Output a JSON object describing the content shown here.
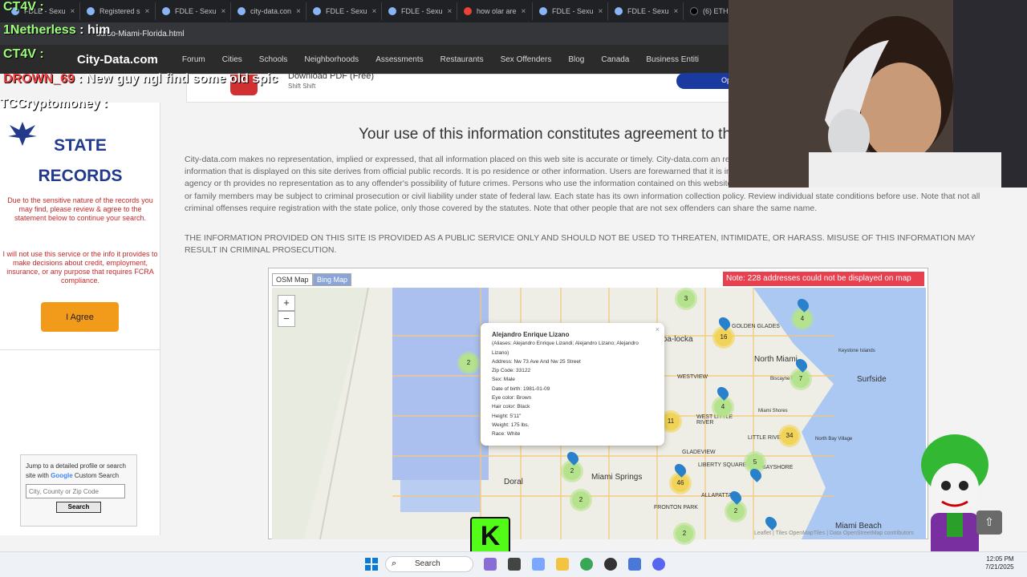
{
  "browser": {
    "tabs": [
      {
        "label": "FDLE - Sexu",
        "icon": "fdle-icon"
      },
      {
        "label": "Registered s",
        "icon": "globe-icon"
      },
      {
        "label": "FDLE - Sexu",
        "icon": "fdle-icon"
      },
      {
        "label": "city-data.con",
        "icon": "globe-icon"
      },
      {
        "label": "FDLE - Sexu",
        "icon": "fdle-icon"
      },
      {
        "label": "FDLE - Sexu",
        "icon": "fdle-icon"
      },
      {
        "label": "how olar are",
        "icon": "google-icon"
      },
      {
        "label": "FDLE - Sexu",
        "icon": "fdle-icon"
      },
      {
        "label": "FDLE - Sexu",
        "icon": "fdle-icon"
      },
      {
        "label": "(6) ETHM",
        "icon": "x-icon"
      }
    ],
    "url": "so/so-Miami-Florida.html"
  },
  "site": {
    "logo": "City-Data.com",
    "nav": [
      "Forum",
      "Cities",
      "Schools",
      "Neighborhoods",
      "Assessments",
      "Restaurants",
      "Sex Offenders",
      "Blog",
      "Canada",
      "Business Entiti"
    ],
    "ad": {
      "title": "Download PDF (Free)",
      "sub": "Shift Shift",
      "button": "Op"
    }
  },
  "left": {
    "title1": "STATE",
    "title2": "RECORDS",
    "warning1": "Due to the sensitive nature of the records you may find, please review & agree to the statement below to continue your search.",
    "warning2": "I will not use this service or the info it provides to make decisions about credit, employment, insurance, or any purpose that requires FCRA compliance.",
    "agree_button": "I Agree",
    "search_intro": "Jump to a detailed profile or search site with",
    "search_brand": "Google",
    "search_brand_suffix": " Custom Search",
    "search_placeholder": "City, County or Zip Code",
    "search_button": "Search"
  },
  "main": {
    "heading": "Your use of this information constitutes agreement to the",
    "para1": "City-data.com makes no representation, implied or expressed, that all information placed on this web site is accurate or timely. City-data.com an resulting from reliance on this information or lack thereof. The information that is displayed on this site derives from official public records. It is po residence or other information. Users are forewarned that it is incumbent upon them to verify information with the responsible state agency or th provides no representation as to any offender's possibility of future crimes. Persons who use the information contained on this website to threaten, intimidate, or harass any individual, including registrants or family members may be subject to criminal prosecution or civil liability under state of federal law. Each state has its own information collection policy. Review individual state conditions before use. Note that not all criminal offenses require registration with the state police, only those covered by the statutes. Note that other people that are not sex offenders can share the same name.",
    "para2": "THE INFORMATION PROVIDED ON THIS SITE IS PROVIDED AS A PUBLIC SERVICE ONLY AND SHOULD NOT BE USED TO THREATEN, INTIMIDATE, OR HARASS. MISUSE OF THIS INFORMATION MAY RESULT IN CRIMINAL PROSECUTION."
  },
  "map": {
    "tab_osm": "OSM Map",
    "tab_bing": "Bing Map",
    "note": "Note: 228 addresses could not be displayed on map",
    "zoom_in": "+",
    "zoom_out": "−",
    "labels": [
      "Opa-locka",
      "North Miami",
      "Surfside",
      "Doral",
      "Miami Springs",
      "Miami Beach",
      "GOLDEN GLADES",
      "WESTVIEW",
      "WEST LITTLE RIVER",
      "LITTLE RIVER",
      "GLADEVIEW",
      "LIBERTY SQUARE",
      "BAYSHORE",
      "ALLAPATTAH",
      "FRONTON PARK",
      "Biscayne Park",
      "Keystone Islands",
      "Miami Shores",
      "North Bay Village"
    ],
    "clusters": [
      "3",
      "4",
      "16",
      "2",
      "7",
      "4",
      "11",
      "34",
      "5",
      "46",
      "2",
      "2",
      "2",
      "2"
    ],
    "attribution": "Leaflet | Tiles OpenMapTiles | Data OpenStreetMap contributors",
    "popup": {
      "name": "Alejandro Enrique Lizano",
      "aliases": "(Aliases: Alejandro Enrique Lizandi; Alejandro Lizano; Alejandro Lizano)",
      "address": "Address: Nw 73 Ave And Nw 25 Street",
      "zip": "Zip Code: 33122",
      "sex": "Sex: Male",
      "dob": "Date of birth: 1981-01-09",
      "eye": "Eye color: Brown",
      "hair": "Hair color: Black",
      "height": "Height: 5'11\"",
      "weight": "Weight: 175 lbs.",
      "race": "Race: White"
    }
  },
  "overlay": {
    "chat": [
      {
        "user": "CT4V",
        "msg": ":"
      },
      {
        "user": "1Netherless",
        "msg": ": him"
      },
      {
        "user": "CT4V",
        "msg": ":"
      },
      {
        "user": "DROWN_69",
        "msg": ": New guy ngl find some old spic"
      },
      {
        "user": "TCCryptomoney",
        "msg": ":"
      }
    ],
    "kick_logo": "K"
  },
  "taskbar": {
    "search": "Search",
    "time": "12:05 PM",
    "date": "7/21/2025"
  }
}
